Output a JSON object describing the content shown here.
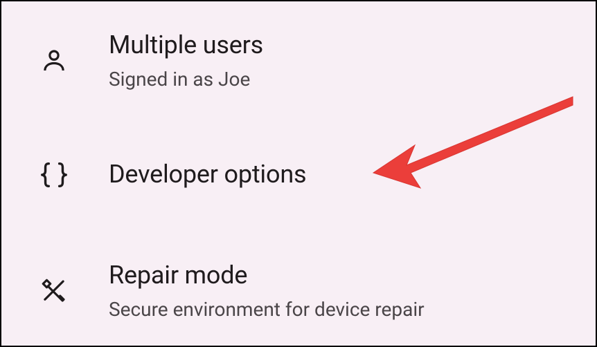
{
  "settings": {
    "items": [
      {
        "title": "Multiple users",
        "subtitle": "Signed in as Joe"
      },
      {
        "title": "Developer options",
        "subtitle": ""
      },
      {
        "title": "Repair mode",
        "subtitle": "Secure environment for device repair"
      }
    ]
  },
  "colors": {
    "background": "#f8eff5",
    "text_primary": "#1f1b1d",
    "text_secondary": "#4a4548",
    "icon": "#1f1b1d",
    "arrow": "#eb3e3a"
  }
}
